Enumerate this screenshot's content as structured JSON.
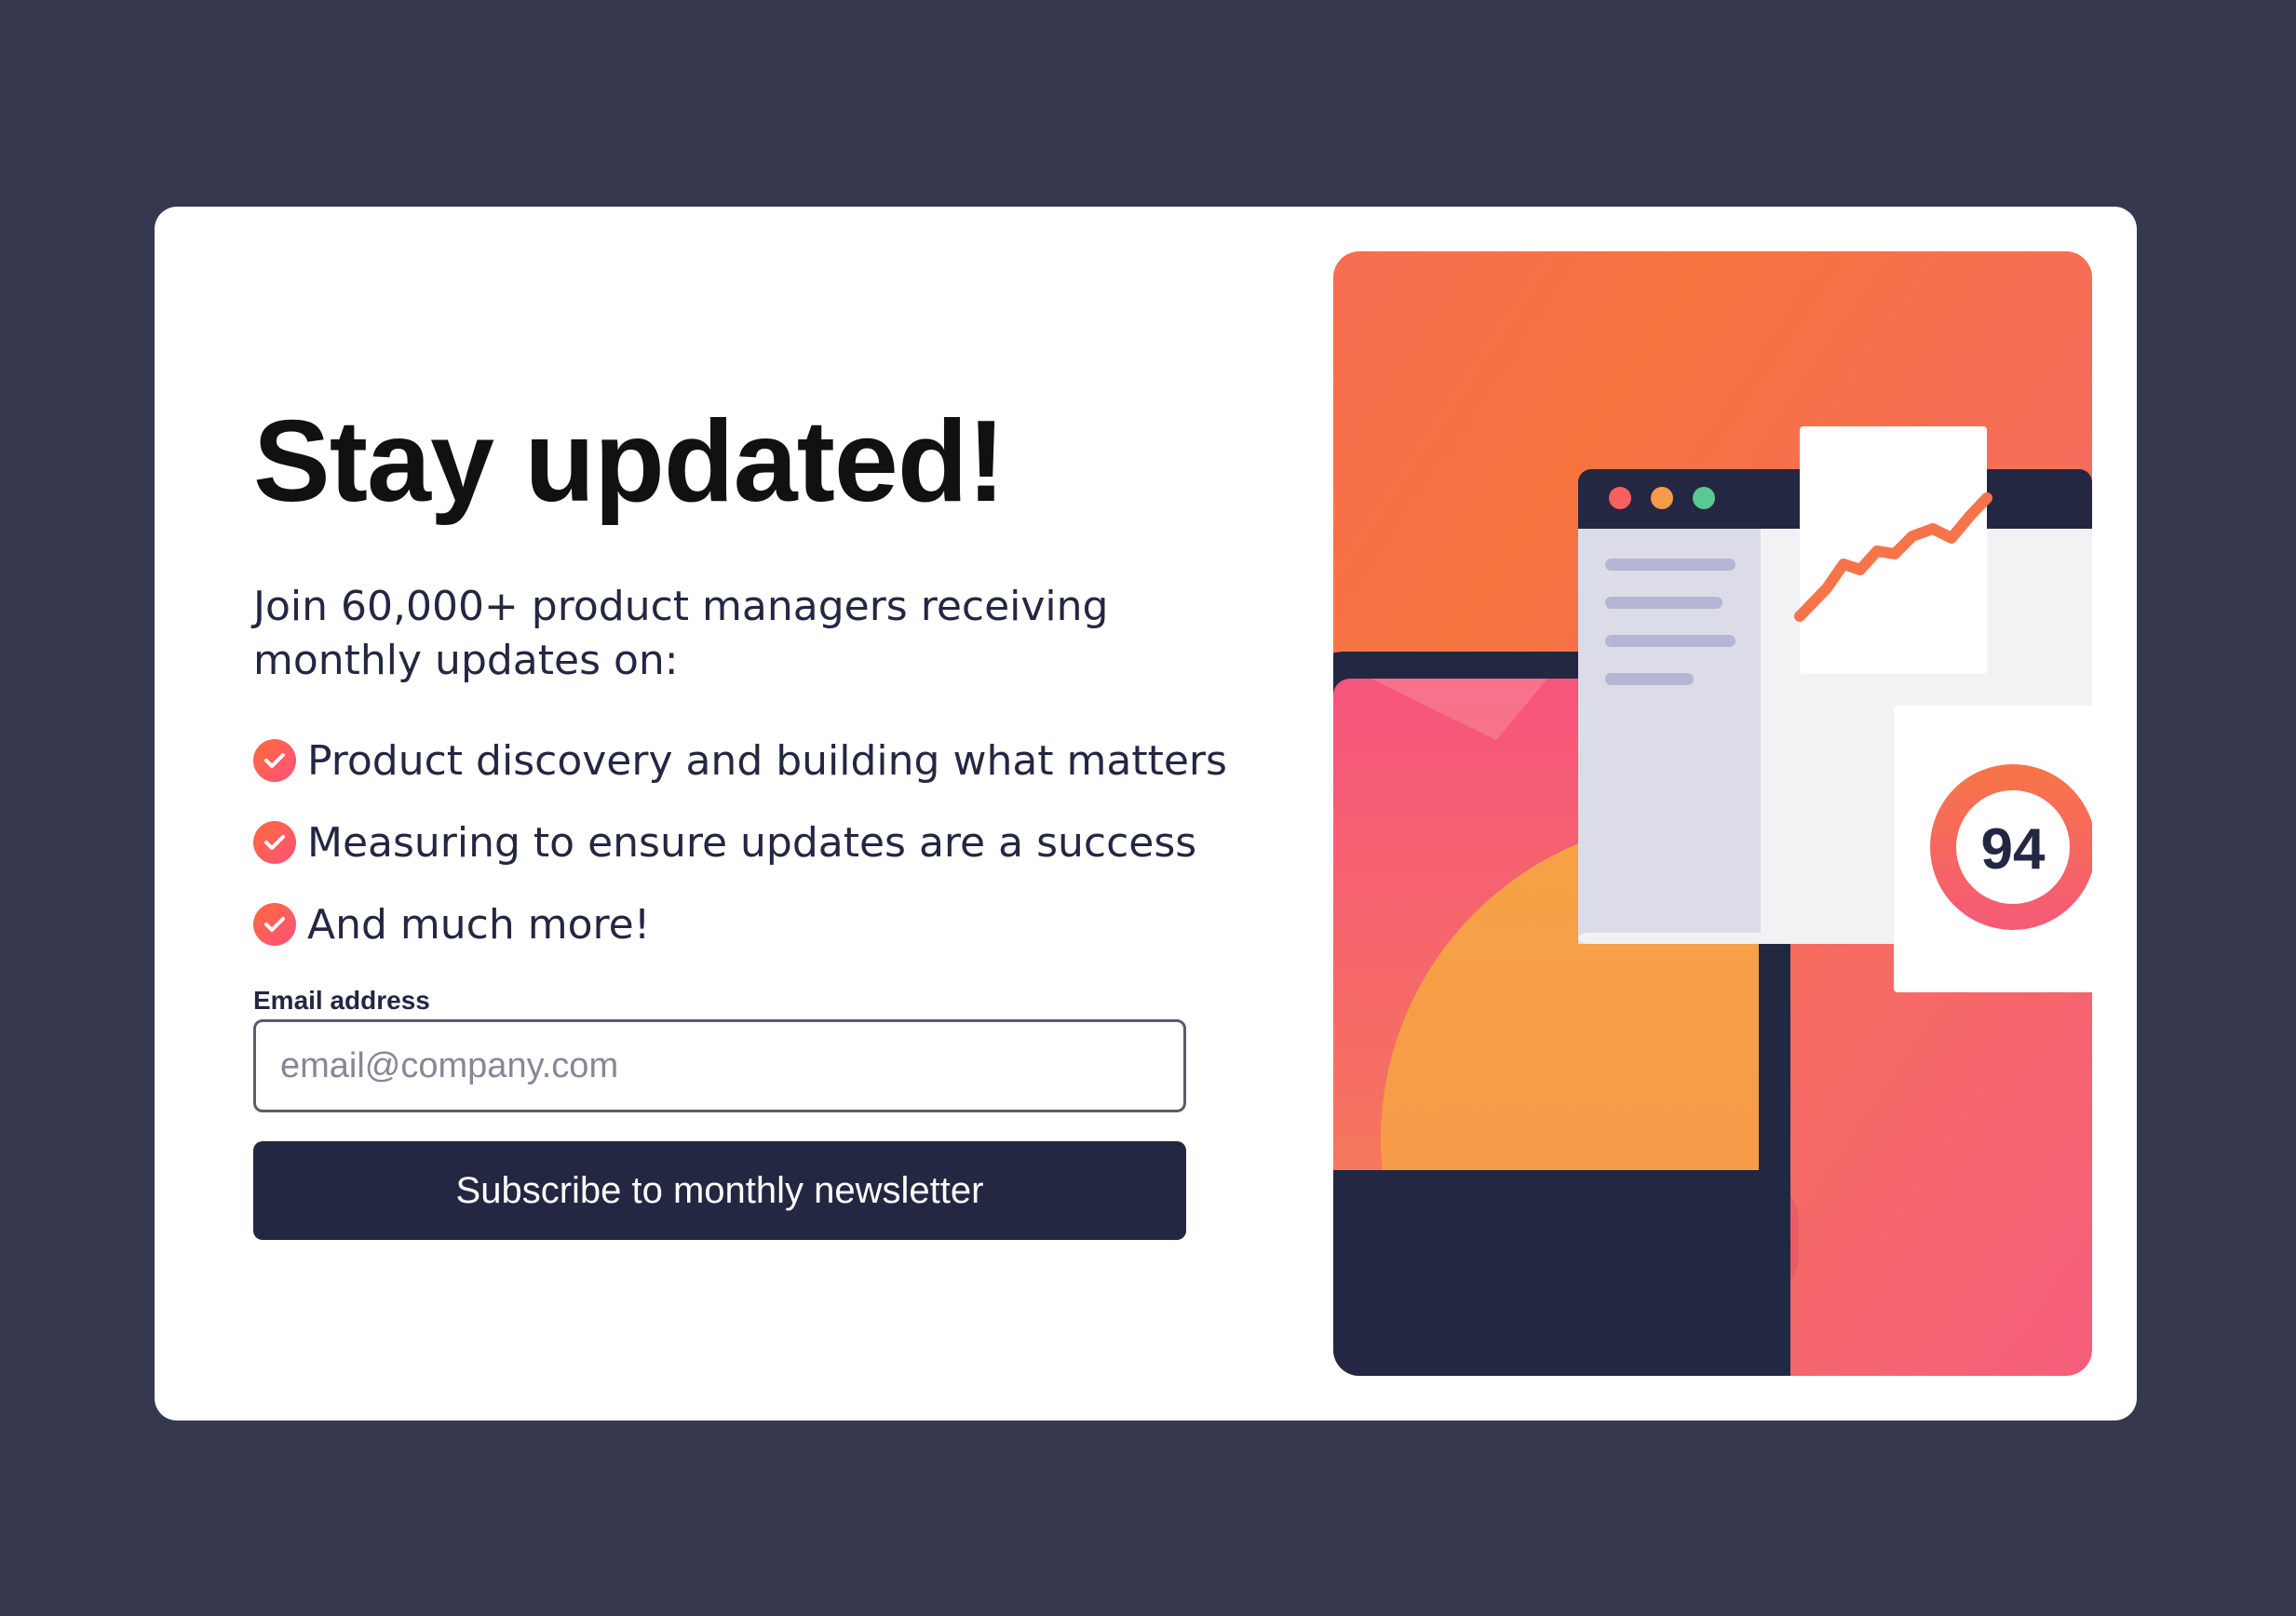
{
  "signup": {
    "title": "Stay updated!",
    "intro": "Join 60,000+ product managers receiving monthly updates on:",
    "bullets": [
      "Product discovery and building what matters",
      "Measuring to ensure updates are a success",
      "And much more!"
    ],
    "email_label": "Email address",
    "email_placeholder": "email@company.com",
    "email_value": "",
    "subscribe_label": "Subscribe to monthly newsletter"
  },
  "illustration": {
    "score": "94"
  },
  "colors": {
    "page_background": "#36384d",
    "card_background": "#ffffff",
    "dark_navy": "#242742",
    "accent_tomato": "#ff6155",
    "gradient_orange": "#ff6a3a",
    "gradient_pink": "#ff527b"
  }
}
